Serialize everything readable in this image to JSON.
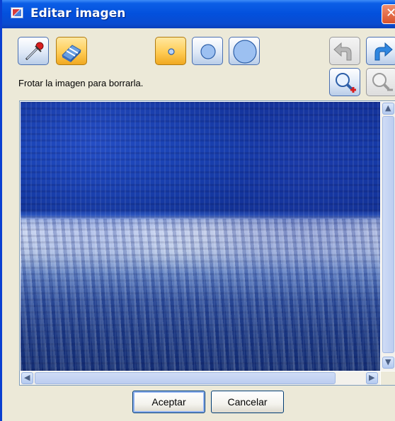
{
  "window": {
    "title": "Editar imagen",
    "close_symbol": "✕"
  },
  "toolbar": {
    "eyedropper_icon": "eyedropper-icon",
    "eraser_icon": "eraser-icon",
    "brush_small_icon": "brush-small-icon",
    "brush_medium_icon": "brush-medium-icon",
    "brush_large_icon": "brush-large-icon",
    "undo_icon": "undo-icon",
    "redo_icon": "redo-icon",
    "zoom_in_icon": "zoom-in-icon",
    "zoom_out_icon": "zoom-out-icon"
  },
  "hint": "Frotar la imagen para borrarla.",
  "canvas": {
    "image_description_icon": "photo-icon",
    "scroll_up": "▲",
    "scroll_down": "▼",
    "scroll_left": "◀",
    "scroll_right": "▶"
  },
  "buttons": {
    "ok": "Aceptar",
    "cancel": "Cancelar"
  },
  "colors": {
    "titlebar": "#0350dc",
    "dialog_bg": "#ece9d8",
    "accent_yellow": "#ffcc55"
  }
}
